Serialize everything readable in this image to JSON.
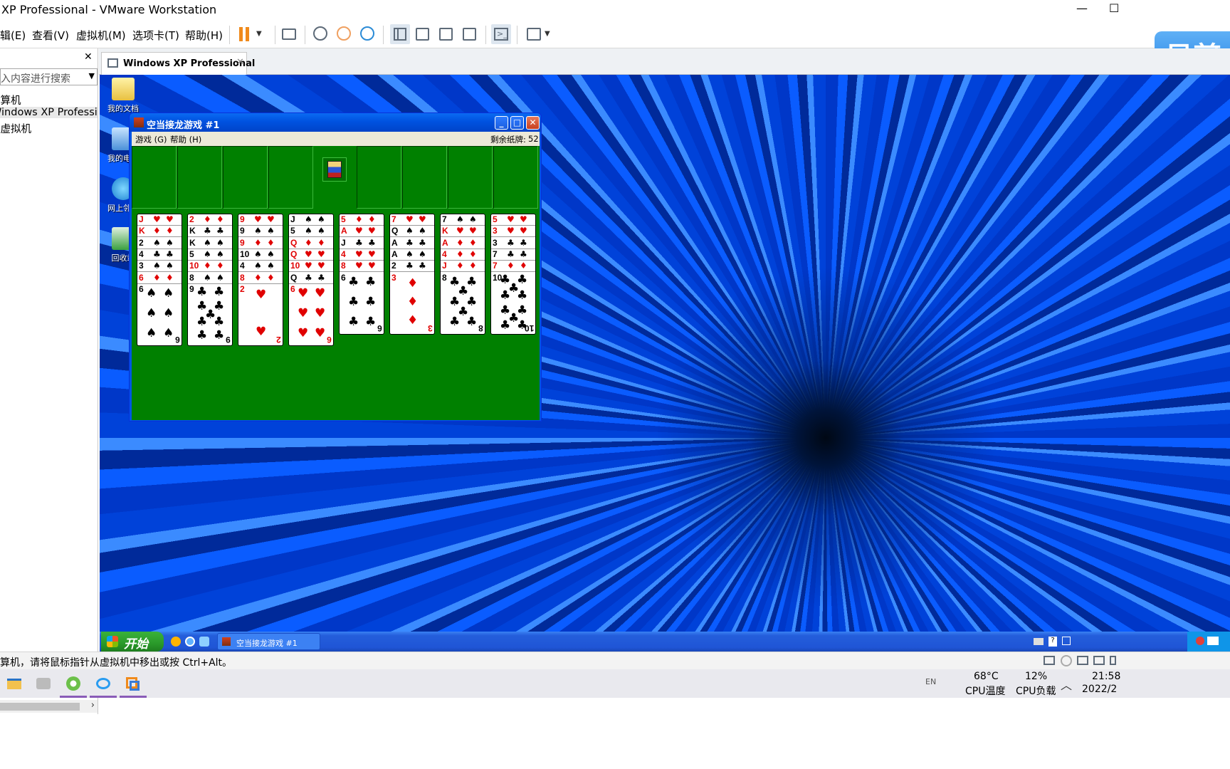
{
  "window_title": "XP Professional - VMware Workstation",
  "window_controls": {
    "minimize": "—",
    "maximize": "☐"
  },
  "menu": [
    "辑(E)",
    "查看(V)",
    "虚拟机(M)",
    "选项卡(T)",
    "帮助(H)"
  ],
  "library": {
    "close": "✕",
    "search_placeholder": "键入内容进行搜索",
    "items": [
      "计算机",
      "Windows XP Professional",
      "的虚拟机"
    ]
  },
  "vm_tab": {
    "label": "Windows XP Professional",
    "close": "✕"
  },
  "desktop_icons": [
    "我的文档",
    "我的电脑",
    "网上邻居",
    "回收站"
  ],
  "freecell": {
    "title": "空当接龙游戏 #1",
    "menu_game": "游戏 (G)",
    "menu_help": "帮助 (H)",
    "cards_left_label": "剩余纸牌:",
    "cards_left_value": "52",
    "columns": [
      {
        "cards": [
          [
            "J",
            "♥"
          ],
          [
            "K",
            "♦"
          ],
          [
            "2",
            "♠"
          ],
          [
            "4",
            "♣"
          ],
          [
            "3",
            "♠"
          ],
          [
            "6",
            "♦"
          ],
          [
            "6",
            "♠"
          ]
        ]
      },
      {
        "cards": [
          [
            "2",
            "♦"
          ],
          [
            "K",
            "♣"
          ],
          [
            "K",
            "♠"
          ],
          [
            "5",
            "♠"
          ],
          [
            "10",
            "♦"
          ],
          [
            "8",
            "♠"
          ],
          [
            "9",
            "♣"
          ]
        ]
      },
      {
        "cards": [
          [
            "9",
            "♥"
          ],
          [
            "9",
            "♠"
          ],
          [
            "9",
            "♦"
          ],
          [
            "10",
            "♠"
          ],
          [
            "4",
            "♠"
          ],
          [
            "8",
            "♦"
          ],
          [
            "2",
            "♥"
          ]
        ]
      },
      {
        "cards": [
          [
            "J",
            "♠"
          ],
          [
            "5",
            "♠"
          ],
          [
            "Q",
            "♦"
          ],
          [
            "Q",
            "♥"
          ],
          [
            "10",
            "♥"
          ],
          [
            "Q",
            "♣"
          ],
          [
            "6",
            "♥"
          ]
        ]
      },
      {
        "cards": [
          [
            "5",
            "♦"
          ],
          [
            "A",
            "♥"
          ],
          [
            "J",
            "♣"
          ],
          [
            "4",
            "♥"
          ],
          [
            "8",
            "♥"
          ],
          [
            "6",
            "♣"
          ]
        ]
      },
      {
        "cards": [
          [
            "7",
            "♥"
          ],
          [
            "Q",
            "♠"
          ],
          [
            "A",
            "♣"
          ],
          [
            "A",
            "♠"
          ],
          [
            "2",
            "♣"
          ],
          [
            "3",
            "♦"
          ]
        ]
      },
      {
        "cards": [
          [
            "7",
            "♠"
          ],
          [
            "K",
            "♥"
          ],
          [
            "A",
            "♦"
          ],
          [
            "4",
            "♦"
          ],
          [
            "J",
            "♦"
          ],
          [
            "8",
            "♣"
          ]
        ]
      },
      {
        "cards": [
          [
            "5",
            "♥"
          ],
          [
            "3",
            "♥"
          ],
          [
            "3",
            "♣"
          ],
          [
            "7",
            "♣"
          ],
          [
            "7",
            "♦"
          ],
          [
            "10",
            "♣"
          ]
        ]
      }
    ]
  },
  "xp_taskbar": {
    "start": "开始",
    "task_label": "空当接龙游戏 #1"
  },
  "status_bar": {
    "message": "计算机，请将鼠标指针从虚拟机中移出或按 Ctrl+Alt。"
  },
  "win_taskbar": {
    "lang": "EN",
    "cpu_temp_value": "68°C",
    "cpu_temp_label": "CPU温度",
    "cpu_load_value": "12%",
    "cpu_load_label": "CPU负载",
    "time": "21:58",
    "date": "2022/2"
  },
  "watermark": {
    "text": "易剪"
  },
  "colors": {
    "felt": "#008000",
    "xp_blue": "#0055e5",
    "red_suit": "#e00000"
  }
}
